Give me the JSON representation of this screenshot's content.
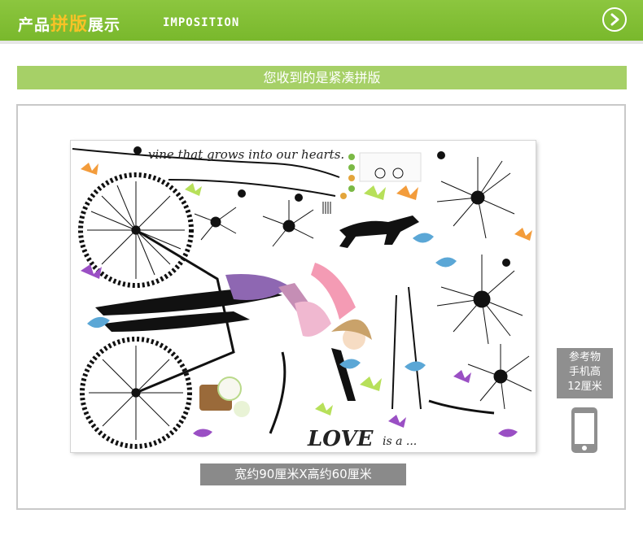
{
  "header": {
    "title_part1": "产品",
    "title_highlight": "拼版",
    "title_part2": "展示",
    "title_sub": "IMPOSITION",
    "next_icon": "chevron-right-circle-icon"
  },
  "subtitle": "您收到的是紧凑拼版",
  "product": {
    "vine_text": "vine that grows into our hearts.",
    "love_text": "LOVE",
    "love_small": "is a ...",
    "dimensions_label": "宽约90厘米X高约60厘米"
  },
  "reference": {
    "line1": "参考物",
    "line2": "手机高",
    "line3": "12厘米",
    "phone_icon": "phone-icon"
  },
  "colors": {
    "header_green": "#8cc63f",
    "subtitle_green": "#a6d067",
    "highlight_yellow": "#f7c227",
    "label_gray": "#8a8a8a"
  }
}
